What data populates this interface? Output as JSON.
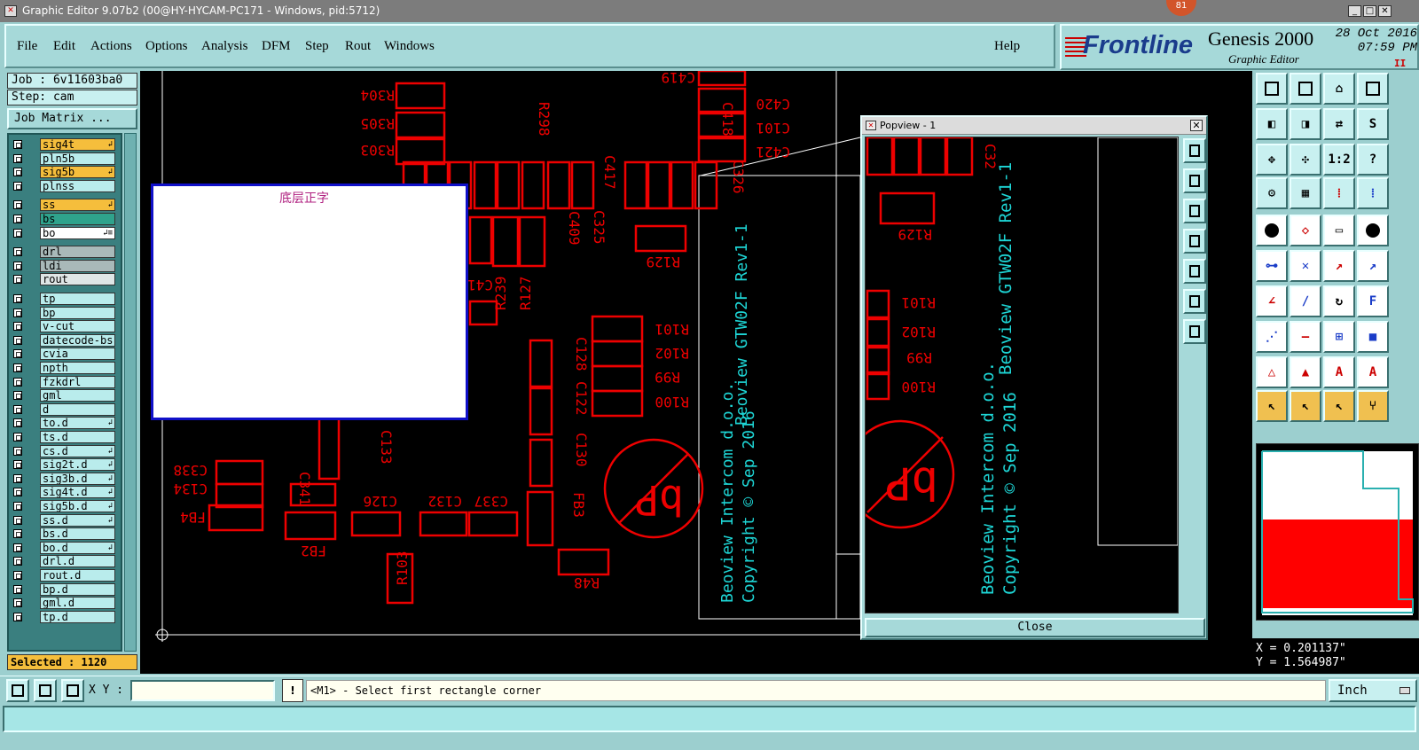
{
  "window": {
    "title": "Graphic Editor 9.07b2 (00@HY-HYCAM-PC171 - Windows, pid:5712)",
    "notification_count": "81"
  },
  "menu": {
    "file": "File",
    "edit": "Edit",
    "actions": "Actions",
    "options": "Options",
    "analysis": "Analysis",
    "dfm": "DFM",
    "step": "Step",
    "rout": "Rout",
    "windows": "Windows",
    "help": "Help"
  },
  "brand": {
    "logo": "Frontline",
    "product": "Genesis 2000",
    "subtitle": "Graphic Editor",
    "date": "28 Oct 2016",
    "time": "07:59 PM",
    "pause": "II"
  },
  "job": {
    "job_label": "Job : 6v11603ba0",
    "step_label": "Step: cam",
    "matrix_button": "Job Matrix ..."
  },
  "layers": [
    {
      "name": "sig4t",
      "style": "y",
      "mark": "↲"
    },
    {
      "name": "pln5b",
      "style": "n",
      "mark": ""
    },
    {
      "name": "sig5b",
      "style": "y",
      "mark": "↲"
    },
    {
      "name": "plnss",
      "style": "n",
      "mark": ""
    },
    {
      "name": "ss",
      "style": "y",
      "mark": "↲"
    },
    {
      "name": "bs",
      "style": "g",
      "mark": ""
    },
    {
      "name": "bo",
      "style": "w",
      "mark": "↲≡"
    },
    {
      "name": "drl",
      "style": "gr",
      "mark": ""
    },
    {
      "name": "ldi",
      "style": "gr",
      "mark": ""
    },
    {
      "name": "rout",
      "style": "lg",
      "mark": ""
    },
    {
      "name": "tp",
      "style": "n",
      "mark": ""
    },
    {
      "name": "bp",
      "style": "n",
      "mark": ""
    },
    {
      "name": "v-cut",
      "style": "n",
      "mark": ""
    },
    {
      "name": "datecode-bs",
      "style": "n",
      "mark": ""
    },
    {
      "name": "cvia",
      "style": "n",
      "mark": ""
    },
    {
      "name": "npth",
      "style": "n",
      "mark": ""
    },
    {
      "name": "fzkdrl",
      "style": "n",
      "mark": ""
    },
    {
      "name": "gml",
      "style": "n",
      "mark": ""
    },
    {
      "name": "d",
      "style": "n",
      "mark": ""
    },
    {
      "name": "to.d",
      "style": "n",
      "mark": "↲"
    },
    {
      "name": "ts.d",
      "style": "n",
      "mark": ""
    },
    {
      "name": "cs.d",
      "style": "n",
      "mark": "↲"
    },
    {
      "name": "sig2t.d",
      "style": "n",
      "mark": "↲"
    },
    {
      "name": "sig3b.d",
      "style": "n",
      "mark": "↲"
    },
    {
      "name": "sig4t.d",
      "style": "n",
      "mark": "↲"
    },
    {
      "name": "sig5b.d",
      "style": "n",
      "mark": "↲"
    },
    {
      "name": "ss.d",
      "style": "n",
      "mark": "↲"
    },
    {
      "name": "bs.d",
      "style": "n",
      "mark": ""
    },
    {
      "name": "bo.d",
      "style": "n",
      "mark": "↲"
    },
    {
      "name": "drl.d",
      "style": "n",
      "mark": ""
    },
    {
      "name": "rout.d",
      "style": "n",
      "mark": ""
    },
    {
      "name": "bp.d",
      "style": "n",
      "mark": ""
    },
    {
      "name": "gml.d",
      "style": "n",
      "mark": ""
    },
    {
      "name": "tp.d",
      "style": "n",
      "mark": ""
    }
  ],
  "selected": "Selected : 1120",
  "canvas_popup_label": "底层正字",
  "popview": {
    "title": "Popview - 1",
    "close_button": "Close"
  },
  "coords": {
    "x": "X = 0.201137\"",
    "y": "Y = 1.564987\""
  },
  "status": {
    "xy_label": "X Y :",
    "xy_value": "",
    "warn": "!",
    "prompt": "<M1> - Select first rectangle corner",
    "units": "Inch"
  },
  "pcb_labels": {
    "r304": "R304",
    "r305": "R305",
    "r303": "R303",
    "r298": "R298",
    "c418": "C418",
    "c419": "C419",
    "c420": "C420",
    "c101": "C101",
    "c421": "C421",
    "c417": "C417",
    "c326": "C326",
    "c409": "C409",
    "c325": "C325",
    "c41": "C41",
    "r129": "R129",
    "r239": "R239",
    "r127": "R127",
    "r101": "R101",
    "r102": "R102",
    "r99": "R99",
    "r100": "R100",
    "c128": "C128",
    "c122": "C122",
    "c130": "C130",
    "fb3": "FB3",
    "c338": "C338",
    "c134": "C134",
    "fb4": "FB4",
    "c341": "C341",
    "fb2": "FB2",
    "c126": "C126",
    "c132": "C132",
    "c337": "C337",
    "r103": "R103",
    "r48": "R48",
    "c133": "C133",
    "bp": "bP",
    "beoview_rev": "Beoview GTW02F Rev1-1",
    "intercom": "Beoview Intercom d.o.o.",
    "copyright": "Copyright © Sep 2016",
    "c32": "C32"
  }
}
